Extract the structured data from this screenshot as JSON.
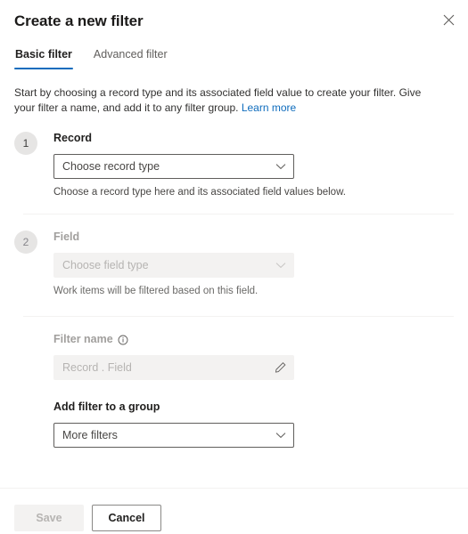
{
  "dialog": {
    "title": "Create a new filter",
    "close_icon": "close-icon"
  },
  "tabs": [
    {
      "label": "Basic filter",
      "active": true
    },
    {
      "label": "Advanced filter",
      "active": false
    }
  ],
  "intro": {
    "text": "Start by choosing a record type and its associated field value to create your filter. Give your filter a name, and add it to any filter group.",
    "link_label": "Learn more"
  },
  "steps": [
    {
      "number": "1",
      "label": "Record",
      "select_value": "Choose record type",
      "hint": "Choose a record type here and its associated field values below.",
      "disabled": false
    },
    {
      "number": "2",
      "label": "Field",
      "select_value": "Choose field type",
      "hint": "Work items will be filtered based on this field.",
      "disabled": true
    }
  ],
  "filter_name": {
    "label": "Filter name",
    "info_icon": "info-icon",
    "placeholder": "Record . Field",
    "value": "",
    "edit_icon": "pencil-icon"
  },
  "filter_group": {
    "label": "Add filter to a group",
    "select_value": "More filters"
  },
  "footer": {
    "save_label": "Save",
    "cancel_label": "Cancel"
  },
  "colors": {
    "accent": "#0f6cbd",
    "link": "#0f6cbd",
    "text": "#323130",
    "disabled_text": "#b6b4b2",
    "control_bg_disabled": "#f3f2f1",
    "border": "#605e5c"
  }
}
